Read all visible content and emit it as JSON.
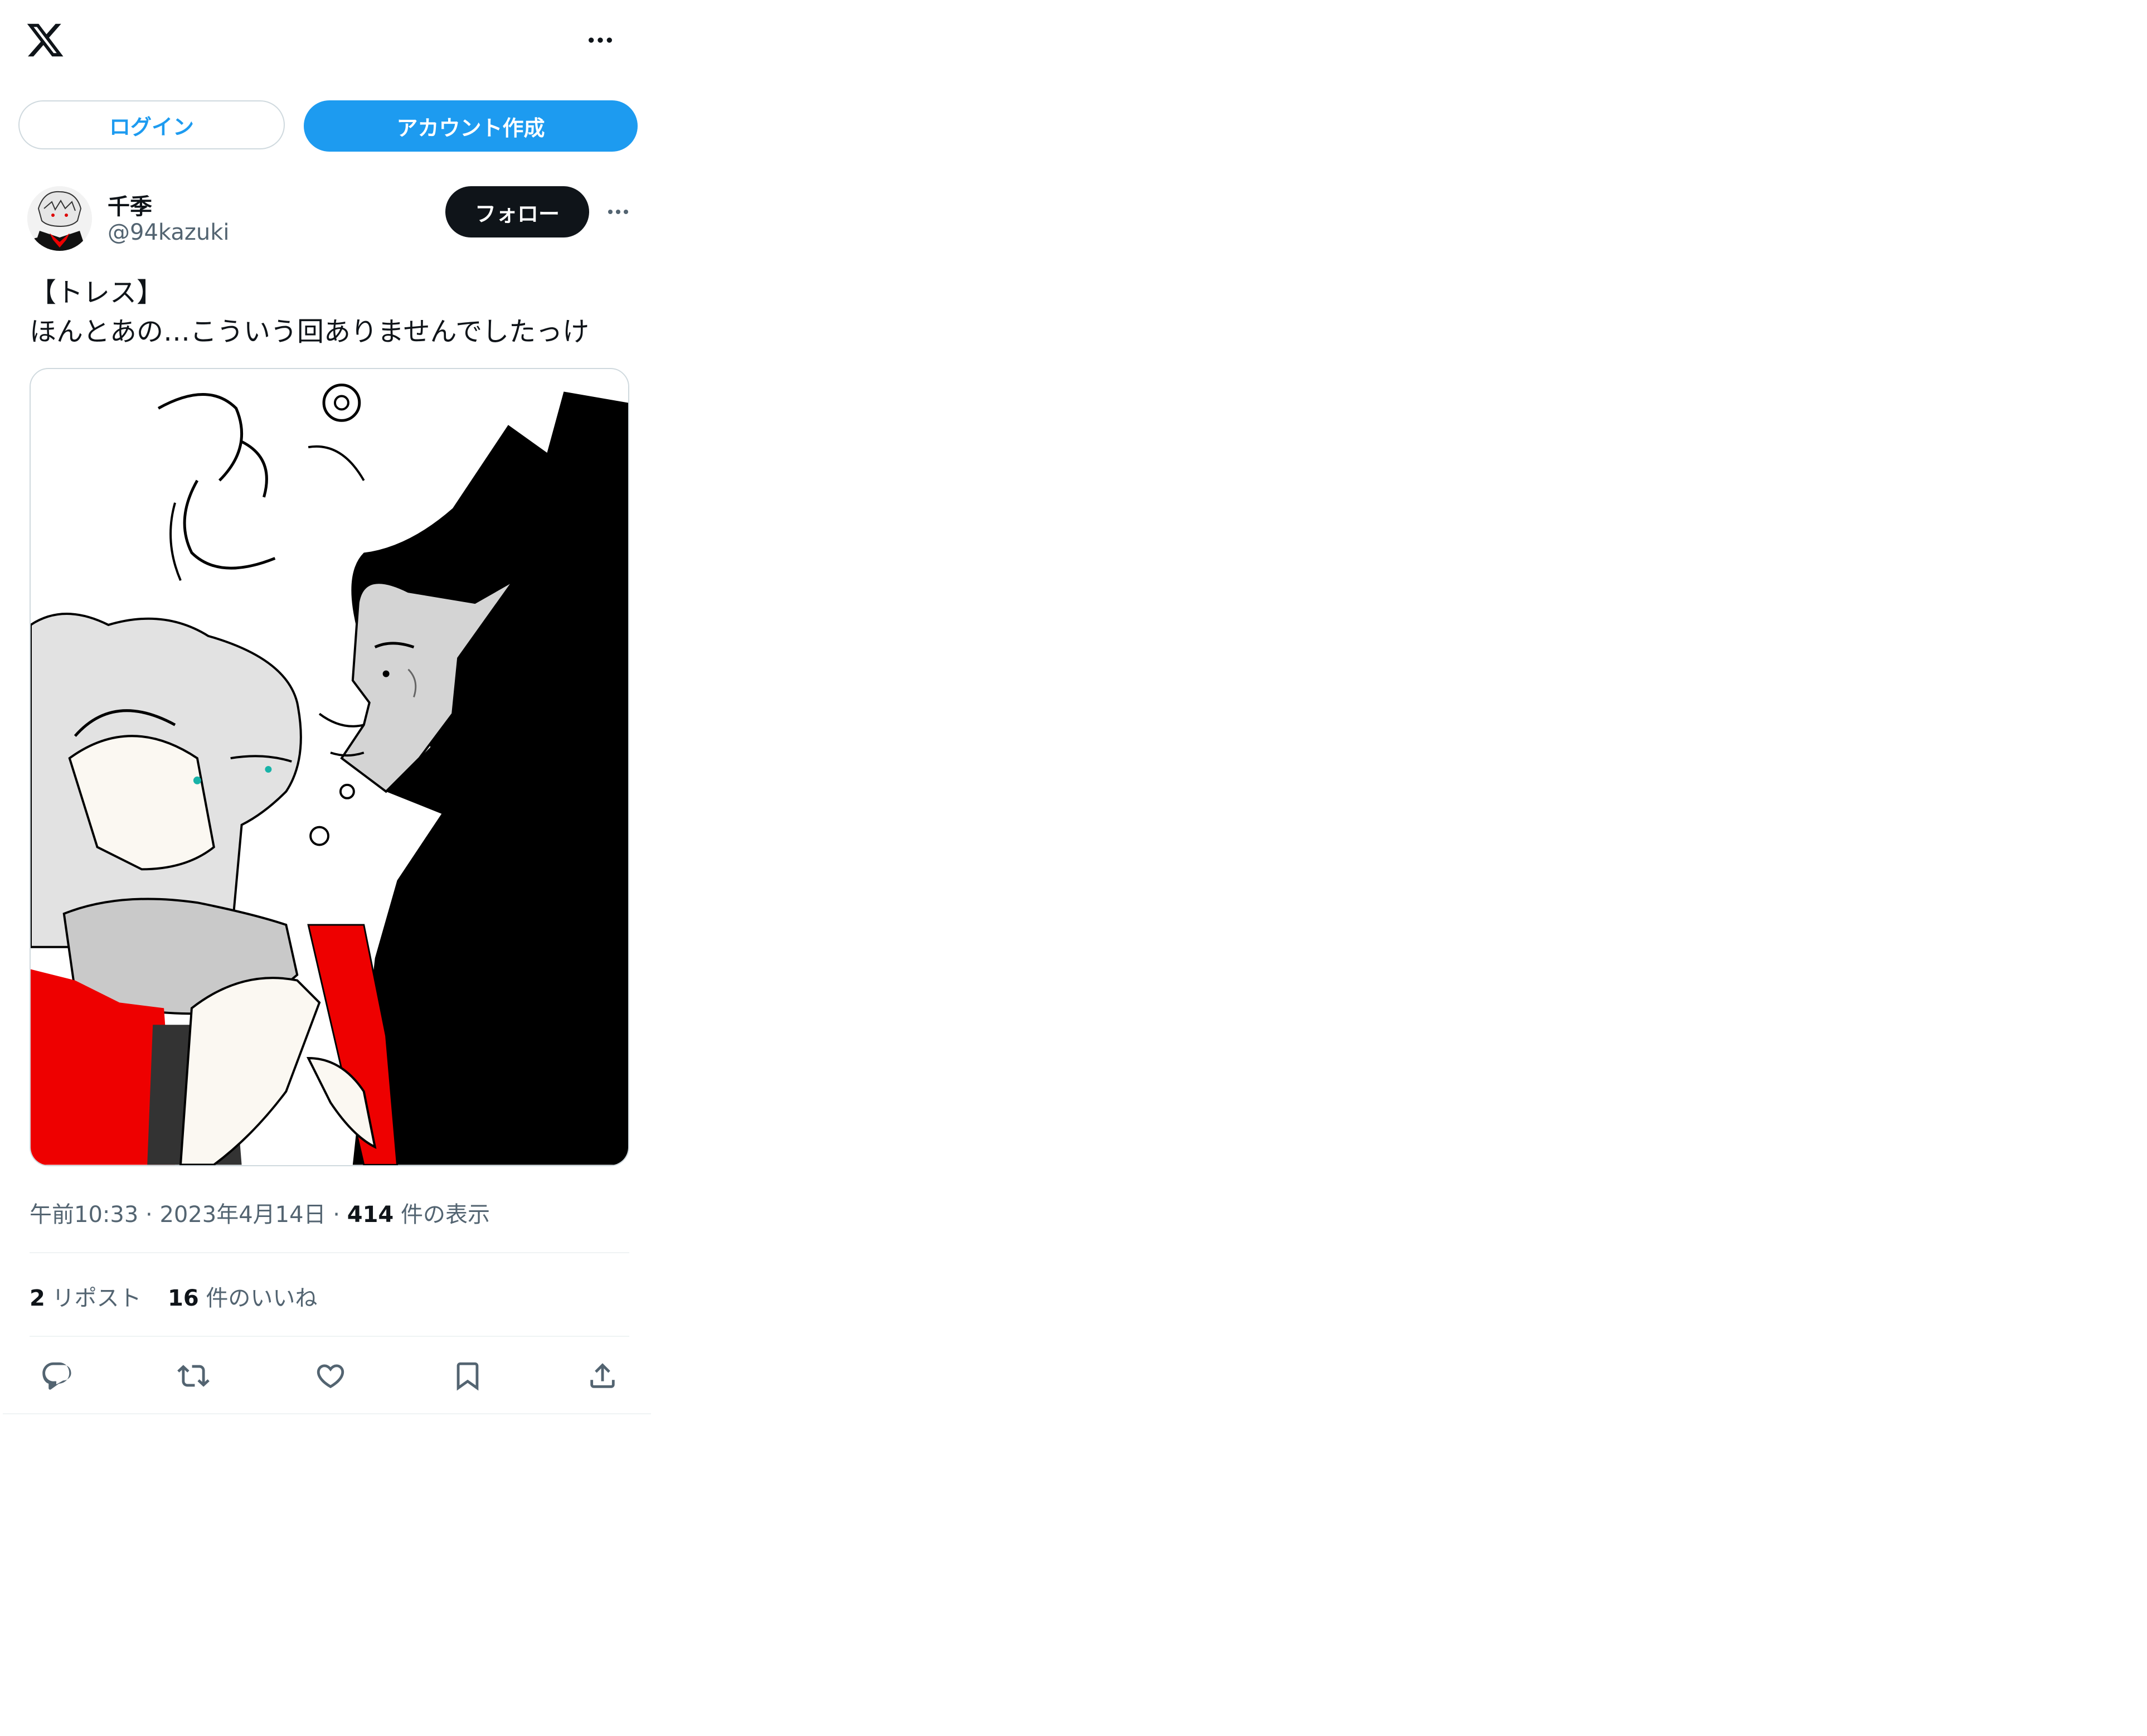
{
  "topbar": {
    "logo_icon": "x-logo-icon",
    "more_icon": "more-horizontal-icon"
  },
  "auth": {
    "login_label": "ログイン",
    "signup_label": "アカウント作成"
  },
  "author": {
    "display_name": "千季",
    "handle": "@94kazuki",
    "follow_label": "フォロー",
    "more_icon": "more-horizontal-icon"
  },
  "tweet": {
    "text": "【トレス】\nほんとあの…こういう回ありませんでしたっけ",
    "media_description_icon": "illustration-image"
  },
  "meta": {
    "time": "午前10:33",
    "separator1": " · ",
    "date": "2023年4月14日",
    "separator2": " · ",
    "views_count": "414",
    "views_label": " 件の表示"
  },
  "stats": {
    "reposts_count": "2",
    "reposts_label": " リポスト",
    "likes_count": "16",
    "likes_label": " 件のいいね"
  },
  "actions": {
    "reply_icon": "reply-icon",
    "repost_icon": "repost-icon",
    "like_icon": "like-icon",
    "bookmark_icon": "bookmark-icon",
    "share_icon": "share-icon"
  },
  "colors": {
    "accent": "#1d9bf0",
    "text": "#0f1419",
    "secondary": "#536471",
    "border": "#cfd9de",
    "divider": "#eff3f4"
  }
}
